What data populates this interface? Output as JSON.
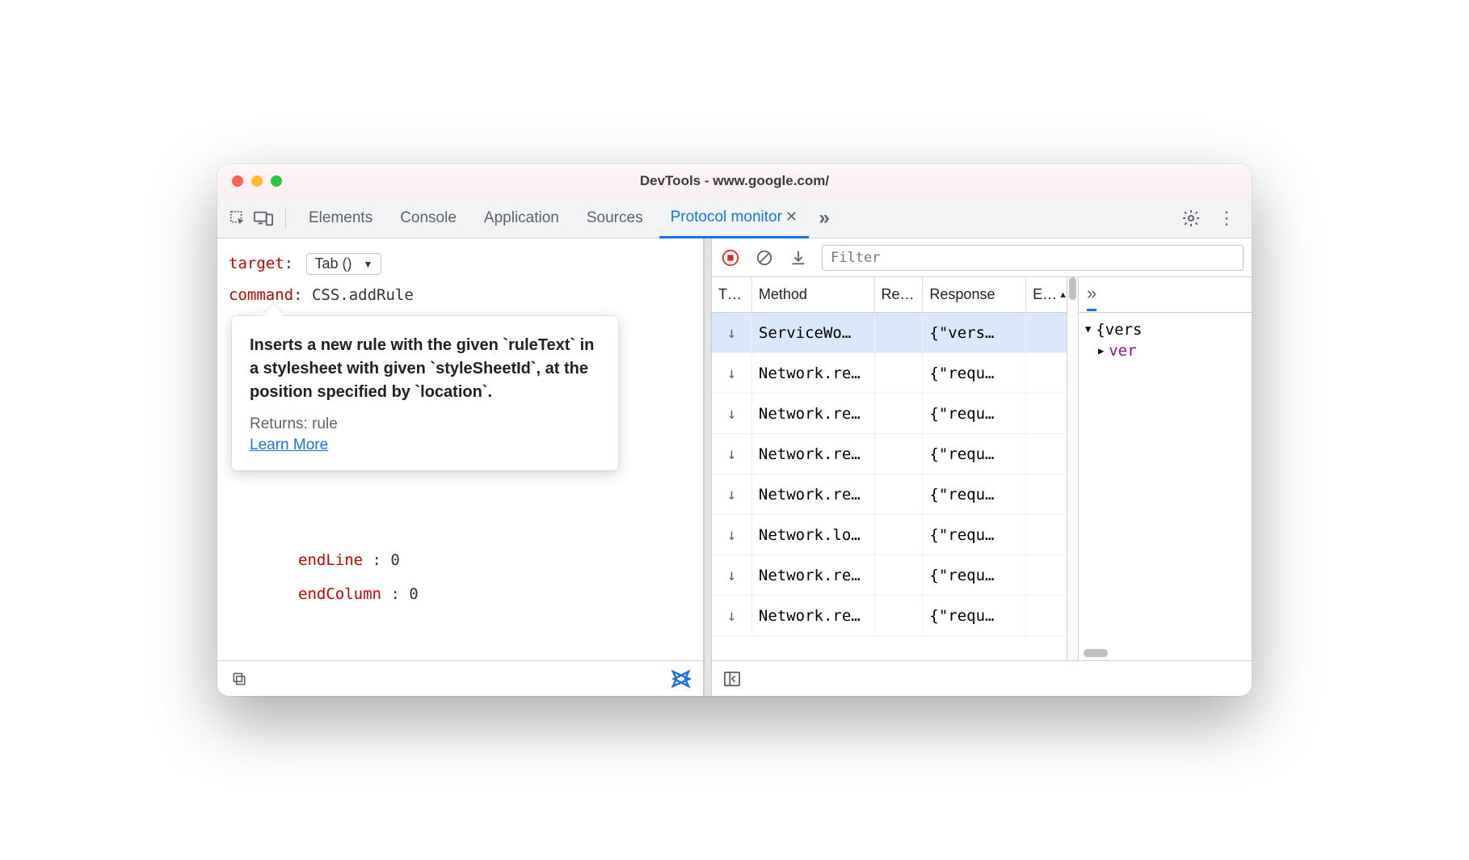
{
  "window": {
    "title": "DevTools - www.google.com/"
  },
  "tabs": {
    "items": [
      "Elements",
      "Console",
      "Application",
      "Sources",
      "Protocol monitor"
    ],
    "activeIndex": 4
  },
  "command_editor": {
    "target_label": "target",
    "target_value": "Tab ()",
    "command_label": "command",
    "command_value": "CSS.addRule",
    "tooltip": {
      "desc": "Inserts a new rule with the given `ruleText` in a stylesheet with given `styleSheetId`, at the position specified by `location`.",
      "returns": "Returns: rule",
      "learn": "Learn More"
    },
    "params": [
      {
        "key": "endLine",
        "value": "0"
      },
      {
        "key": "endColumn",
        "value": "0"
      }
    ]
  },
  "protocol_toolbar": {
    "filter_placeholder": "Filter"
  },
  "table": {
    "columns": [
      "T…",
      "Method",
      "Re…",
      "Response",
      "E…"
    ],
    "rows": [
      {
        "dir": "↓",
        "method": "ServiceWo…",
        "re": "",
        "resp": "{\"vers…",
        "e": "",
        "selected": true
      },
      {
        "dir": "↓",
        "method": "Network.re…",
        "re": "",
        "resp": "{\"requ…",
        "e": ""
      },
      {
        "dir": "↓",
        "method": "Network.re…",
        "re": "",
        "resp": "{\"requ…",
        "e": ""
      },
      {
        "dir": "↓",
        "method": "Network.re…",
        "re": "",
        "resp": "{\"requ…",
        "e": ""
      },
      {
        "dir": "↓",
        "method": "Network.re…",
        "re": "",
        "resp": "{\"requ…",
        "e": ""
      },
      {
        "dir": "↓",
        "method": "Network.lo…",
        "re": "",
        "resp": "{\"requ…",
        "e": ""
      },
      {
        "dir": "↓",
        "method": "Network.re…",
        "re": "",
        "resp": "{\"requ…",
        "e": ""
      },
      {
        "dir": "↓",
        "method": "Network.re…",
        "re": "",
        "resp": "{\"requ…",
        "e": ""
      }
    ]
  },
  "detail": {
    "line1": "{vers",
    "line2_prop": "ver"
  }
}
